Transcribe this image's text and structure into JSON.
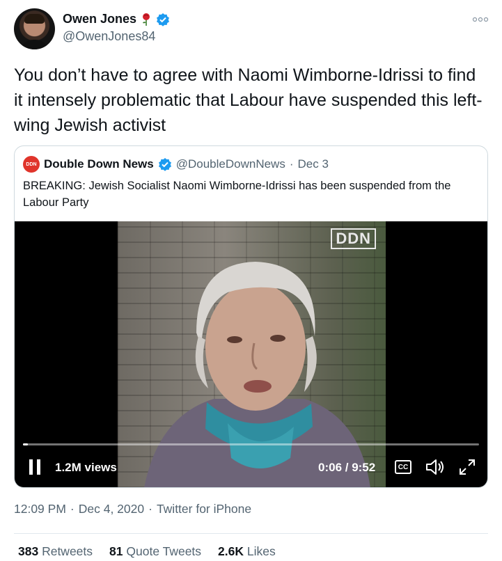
{
  "author": {
    "name": "Owen Jones",
    "handle": "@OwenJones84",
    "rose_icon": "rose-emoji",
    "verified_icon": "verified-badge-icon"
  },
  "tweet": {
    "text": "You don’t have to agree with Naomi Wimborne-Idrissi to find it intensely problematic that Labour have suspended this left-wing Jewish activist"
  },
  "quote": {
    "logo_text": "DDN",
    "name": "Double Down News",
    "handle": "@DoubleDownNews",
    "dot": "·",
    "date": "Dec 3",
    "text": "BREAKING: Jewish Socialist Naomi Wimborne-Idrissi has been suspended from the Labour Party"
  },
  "video": {
    "watermark": "DDN",
    "views": "1.2M views",
    "time": "0:06 / 9:52",
    "cc_label": "CC",
    "progress": 0.01
  },
  "meta": {
    "time": "12:09 PM",
    "date": "Dec 4, 2020",
    "source": "Twitter for iPhone",
    "sep": "·"
  },
  "stats": {
    "retweets_count": "383",
    "retweets_label": "Retweets",
    "quotes_count": "81",
    "quotes_label": "Quote Tweets",
    "likes_count": "2.6K",
    "likes_label": "Likes"
  },
  "colors": {
    "brand_blue": "#1d9bf0",
    "ddn_red": "#e0342b",
    "secondary_text": "#536471"
  }
}
